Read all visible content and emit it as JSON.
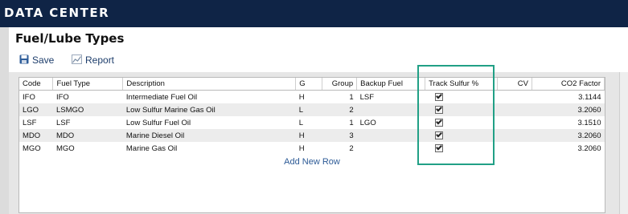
{
  "header": {
    "title": "DATA CENTER"
  },
  "page": {
    "title": "Fuel/Lube Types"
  },
  "toolbar": {
    "save_label": "Save",
    "save_icon": "floppy-disk-icon",
    "report_label": "Report",
    "report_icon": "chart-icon"
  },
  "table": {
    "columns": [
      "Code",
      "Fuel Type",
      "Description",
      "G",
      "Group",
      "Backup Fuel",
      "Track Sulfur %",
      "CV",
      "CO2 Factor"
    ],
    "rows": [
      {
        "code": "IFO",
        "fuel_type": "IFO",
        "description": "Intermediate Fuel Oil",
        "g": "H",
        "group": "1",
        "backup_fuel": "LSF",
        "track_sulfur": true,
        "cv": "",
        "co2_factor": "3.1144"
      },
      {
        "code": "LGO",
        "fuel_type": "LSMGO",
        "description": "Low Sulfur Marine Gas Oil",
        "g": "L",
        "group": "2",
        "backup_fuel": "",
        "track_sulfur": true,
        "cv": "",
        "co2_factor": "3.2060"
      },
      {
        "code": "LSF",
        "fuel_type": "LSF",
        "description": "Low Sulfur Fuel Oil",
        "g": "L",
        "group": "1",
        "backup_fuel": "LGO",
        "track_sulfur": true,
        "cv": "",
        "co2_factor": "3.1510"
      },
      {
        "code": "MDO",
        "fuel_type": "MDO",
        "description": "Marine Diesel Oil",
        "g": "H",
        "group": "3",
        "backup_fuel": "",
        "track_sulfur": true,
        "cv": "",
        "co2_factor": "3.2060"
      },
      {
        "code": "MGO",
        "fuel_type": "MGO",
        "description": "Marine Gas Oil",
        "g": "H",
        "group": "2",
        "backup_fuel": "",
        "track_sulfur": true,
        "cv": "",
        "co2_factor": "3.2060"
      }
    ],
    "add_row_label": "Add New Row"
  },
  "colors": {
    "header_bg": "#0f2446",
    "link": "#2c5a96",
    "highlight": "#21a086"
  }
}
